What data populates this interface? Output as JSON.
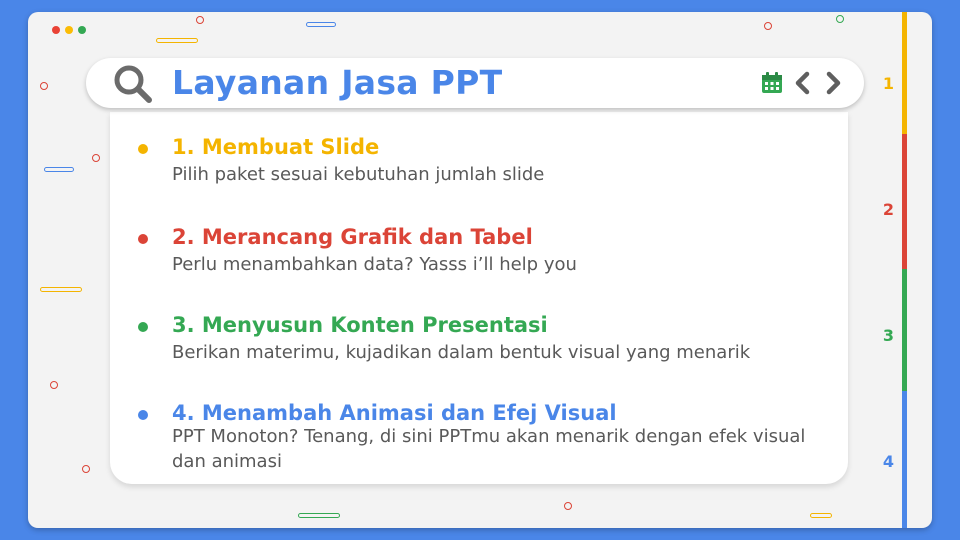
{
  "window": {
    "dot_colors": [
      "#e94235",
      "#fbbc05",
      "#34a853"
    ]
  },
  "search": {
    "title": "Layanan Jasa PPT",
    "icons": [
      "search-icon",
      "calendar-icon",
      "chevron-left-icon",
      "chevron-right-icon"
    ]
  },
  "services": [
    {
      "title": "1. Membuat Slide",
      "desc": "Pilih paket sesuai kebutuhan jumlah slide",
      "color": "#f4b400"
    },
    {
      "title": "2. Merancang Grafik dan Tabel",
      "desc": "Perlu menambahkan data? Yasss i’ll help you",
      "color": "#db4437"
    },
    {
      "title": "3. Menyusun Konten Presentasi",
      "desc": "Berikan materimu, kujadikan dalam bentuk visual yang menarik",
      "color": "#34a853"
    },
    {
      "title": "4. Menambah Animasi dan Efej Visual",
      "desc": "PPT Monoton? Tenang, di sini PPTmu akan menarik dengan efek visual dan animasi",
      "color": "#4a86e8"
    }
  ],
  "tabs": [
    {
      "label": "1",
      "color": "#f4b400"
    },
    {
      "label": "2",
      "color": "#db4437"
    },
    {
      "label": "3",
      "color": "#34a853"
    },
    {
      "label": "4",
      "color": "#4a86e8"
    }
  ],
  "colors": {
    "background": "#4a86e8",
    "frame": "#f3f3f3",
    "accent": "#4a86e8"
  }
}
